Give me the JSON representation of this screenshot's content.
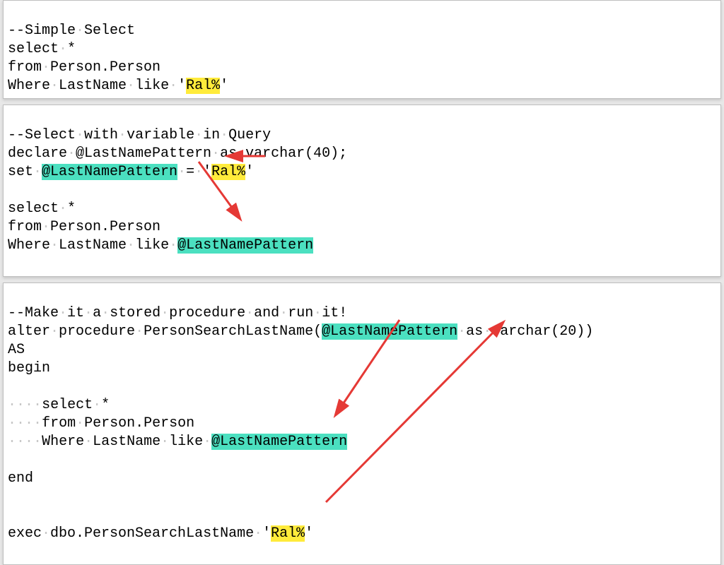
{
  "pane1": {
    "l1": "--Simple·Select",
    "l2": "select·*",
    "l3": "from·Person.Person",
    "l4a": "Where·LastName·like·'",
    "l4b": "Ral%",
    "l4c": "'"
  },
  "pane2": {
    "l1": "--Select·with·variable·in·Query",
    "l2": "declare·@LastNamePattern·as·varchar(40);",
    "l3a": "set·",
    "l3b": "@LastNamePattern",
    "l3c": "·=·'",
    "l3d": "Ral%",
    "l3e": "'",
    "l4": "",
    "l5": "select·*",
    "l6": "from·Person.Person",
    "l7a": "Where·LastName·like·",
    "l7b": "@LastNamePattern"
  },
  "pane3": {
    "l1": "--Make·it·a·stored·procedure·and·run·it!",
    "l2a": "alter·procedure·PersonSearchLastName(",
    "l2b": "@LastNamePattern",
    "l2c": "·as·varchar(20))",
    "l3": "AS",
    "l4": "begin",
    "l5": "",
    "l6": "····select·*",
    "l7": "····from·Person.Person",
    "l8a": "····Where·LastName·like·",
    "l8b": "@LastNamePattern",
    "l9": "",
    "l10": "end",
    "l11": "",
    "l12": "",
    "l13a": "exec·dbo.PersonSearchLastName·'",
    "l13b": "Ral%",
    "l13c": "'"
  }
}
